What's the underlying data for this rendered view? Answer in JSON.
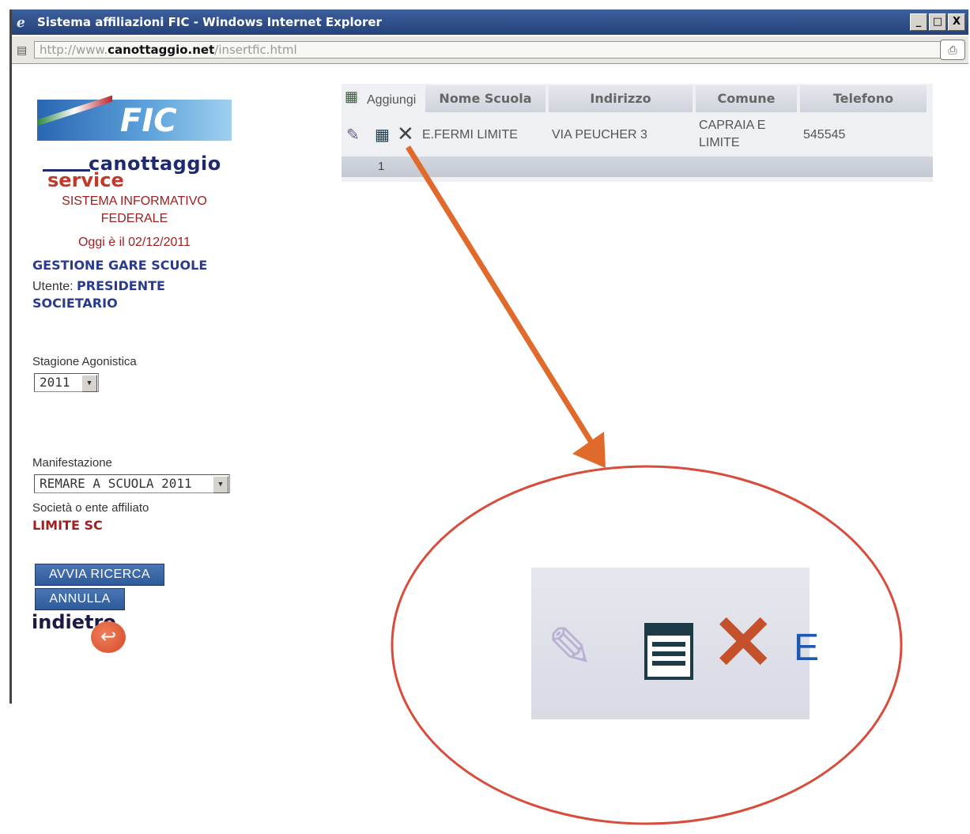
{
  "window": {
    "title": "Sistema affiliazioni FIC - Windows Internet Explorer",
    "buttons": {
      "minimize": "_",
      "maximize": "□",
      "close": "X"
    },
    "address": {
      "prefix": "http://www.",
      "domain": "canottaggio.net",
      "path": "/insertfic.html"
    }
  },
  "sidebar": {
    "logo_fic": "FIC",
    "logo_canottaggio": "canottaggio",
    "logo_service": "service",
    "system_line1": "SISTEMA INFORMATIVO",
    "system_line2": "FEDERALE",
    "today": "Oggi è il 02/12/2011",
    "section_title": "GESTIONE GARE SCUOLE",
    "user_label": "Utente:",
    "user_value_line1": "PRESIDENTE",
    "user_value_line2": "SOCIETARIO",
    "season_label": "Stagione Agonistica",
    "season_value": "2011",
    "event_label": "Manifestazione",
    "event_value": "REMARE A SCUOLA 2011",
    "society_label": "Società o ente affiliato",
    "society_value": "LIMITE SC",
    "search_button": "AVVIA RICERCA",
    "cancel_button": "ANNULLA",
    "back_link": "indietro"
  },
  "grid": {
    "add_label": "Aggiungi",
    "columns": [
      "Nome Scuola",
      "Indirizzo",
      "Comune",
      "Telefono"
    ],
    "rows": [
      {
        "nome": "E.FERMI LIMITE",
        "indirizzo": "VIA PEUCHER 3",
        "comune_1": "CAPRAIA E",
        "comune_2": "LIMITE",
        "telefono": "545545"
      }
    ],
    "page": "1"
  },
  "annotation": {
    "arrow_color": "#e06a2c",
    "circle_color": "#d94b3a",
    "zoom_partial_text": "E"
  }
}
